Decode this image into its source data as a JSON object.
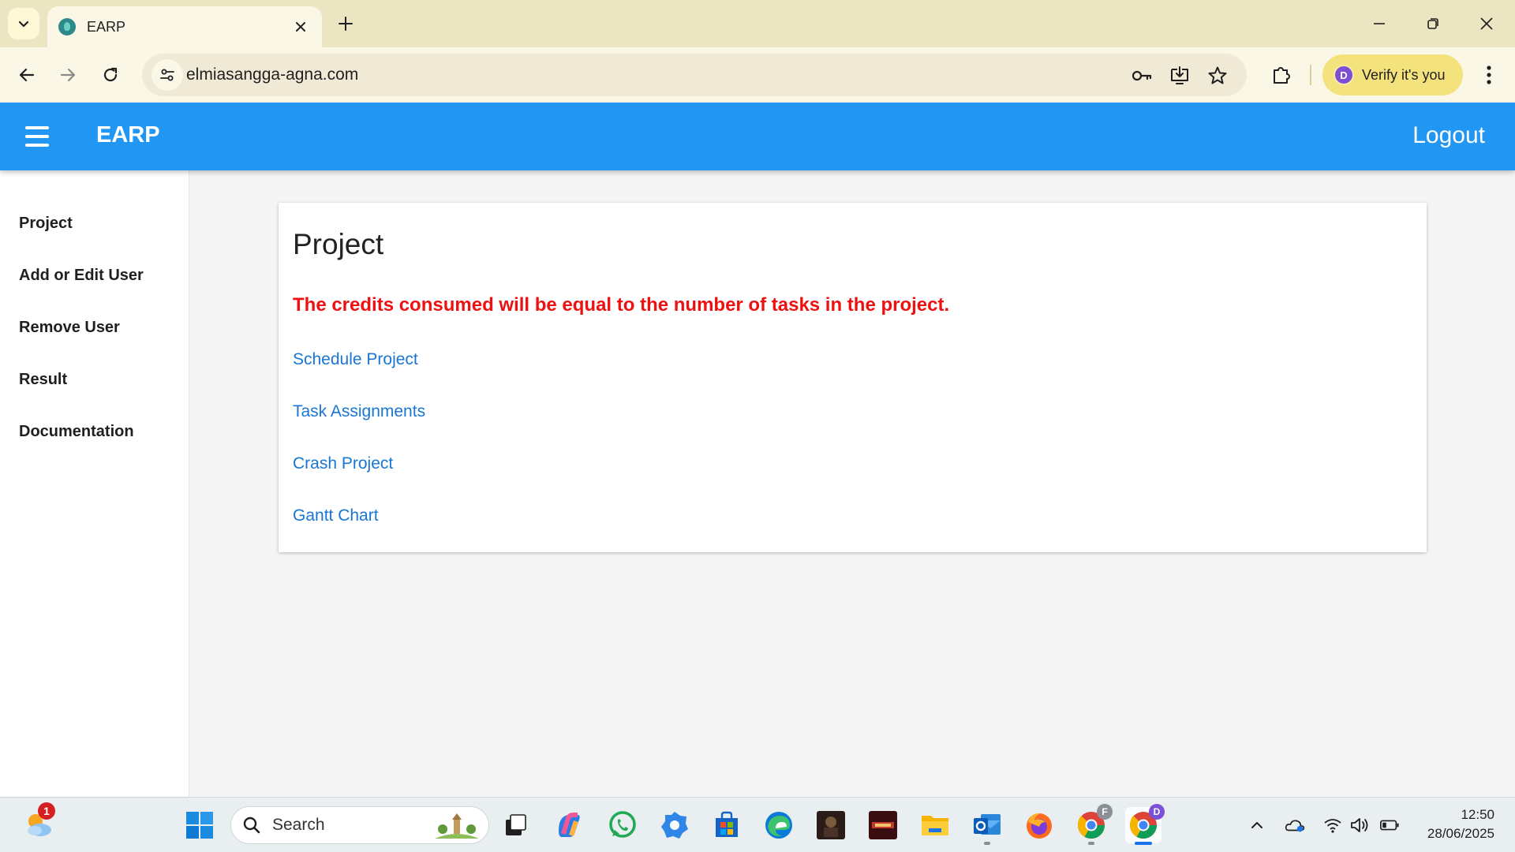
{
  "browser": {
    "tab_title": "EARP",
    "url": "elmiasangga-agna.com",
    "verify_label": "Verify it's you",
    "profile_initial": "D"
  },
  "app": {
    "title": "EARP",
    "logout_label": "Logout",
    "accent_color": "#2196f3"
  },
  "sidebar": {
    "items": [
      {
        "label": "Project"
      },
      {
        "label": "Add or Edit User"
      },
      {
        "label": "Remove User"
      },
      {
        "label": "Result"
      },
      {
        "label": "Documentation"
      }
    ]
  },
  "main": {
    "title": "Project",
    "note": "The credits consumed will be equal to the number of tasks in the project.",
    "note_color": "#ee1111",
    "links": [
      {
        "label": "Schedule Project"
      },
      {
        "label": "Task Assignments"
      },
      {
        "label": "Crash Project"
      },
      {
        "label": "Gantt Chart"
      }
    ]
  },
  "taskbar": {
    "search_placeholder": "Search",
    "weather_badge": "1",
    "chrome_profile_f": "F",
    "chrome_profile_d": "D",
    "time": "12:50",
    "date": "28/06/2025"
  }
}
